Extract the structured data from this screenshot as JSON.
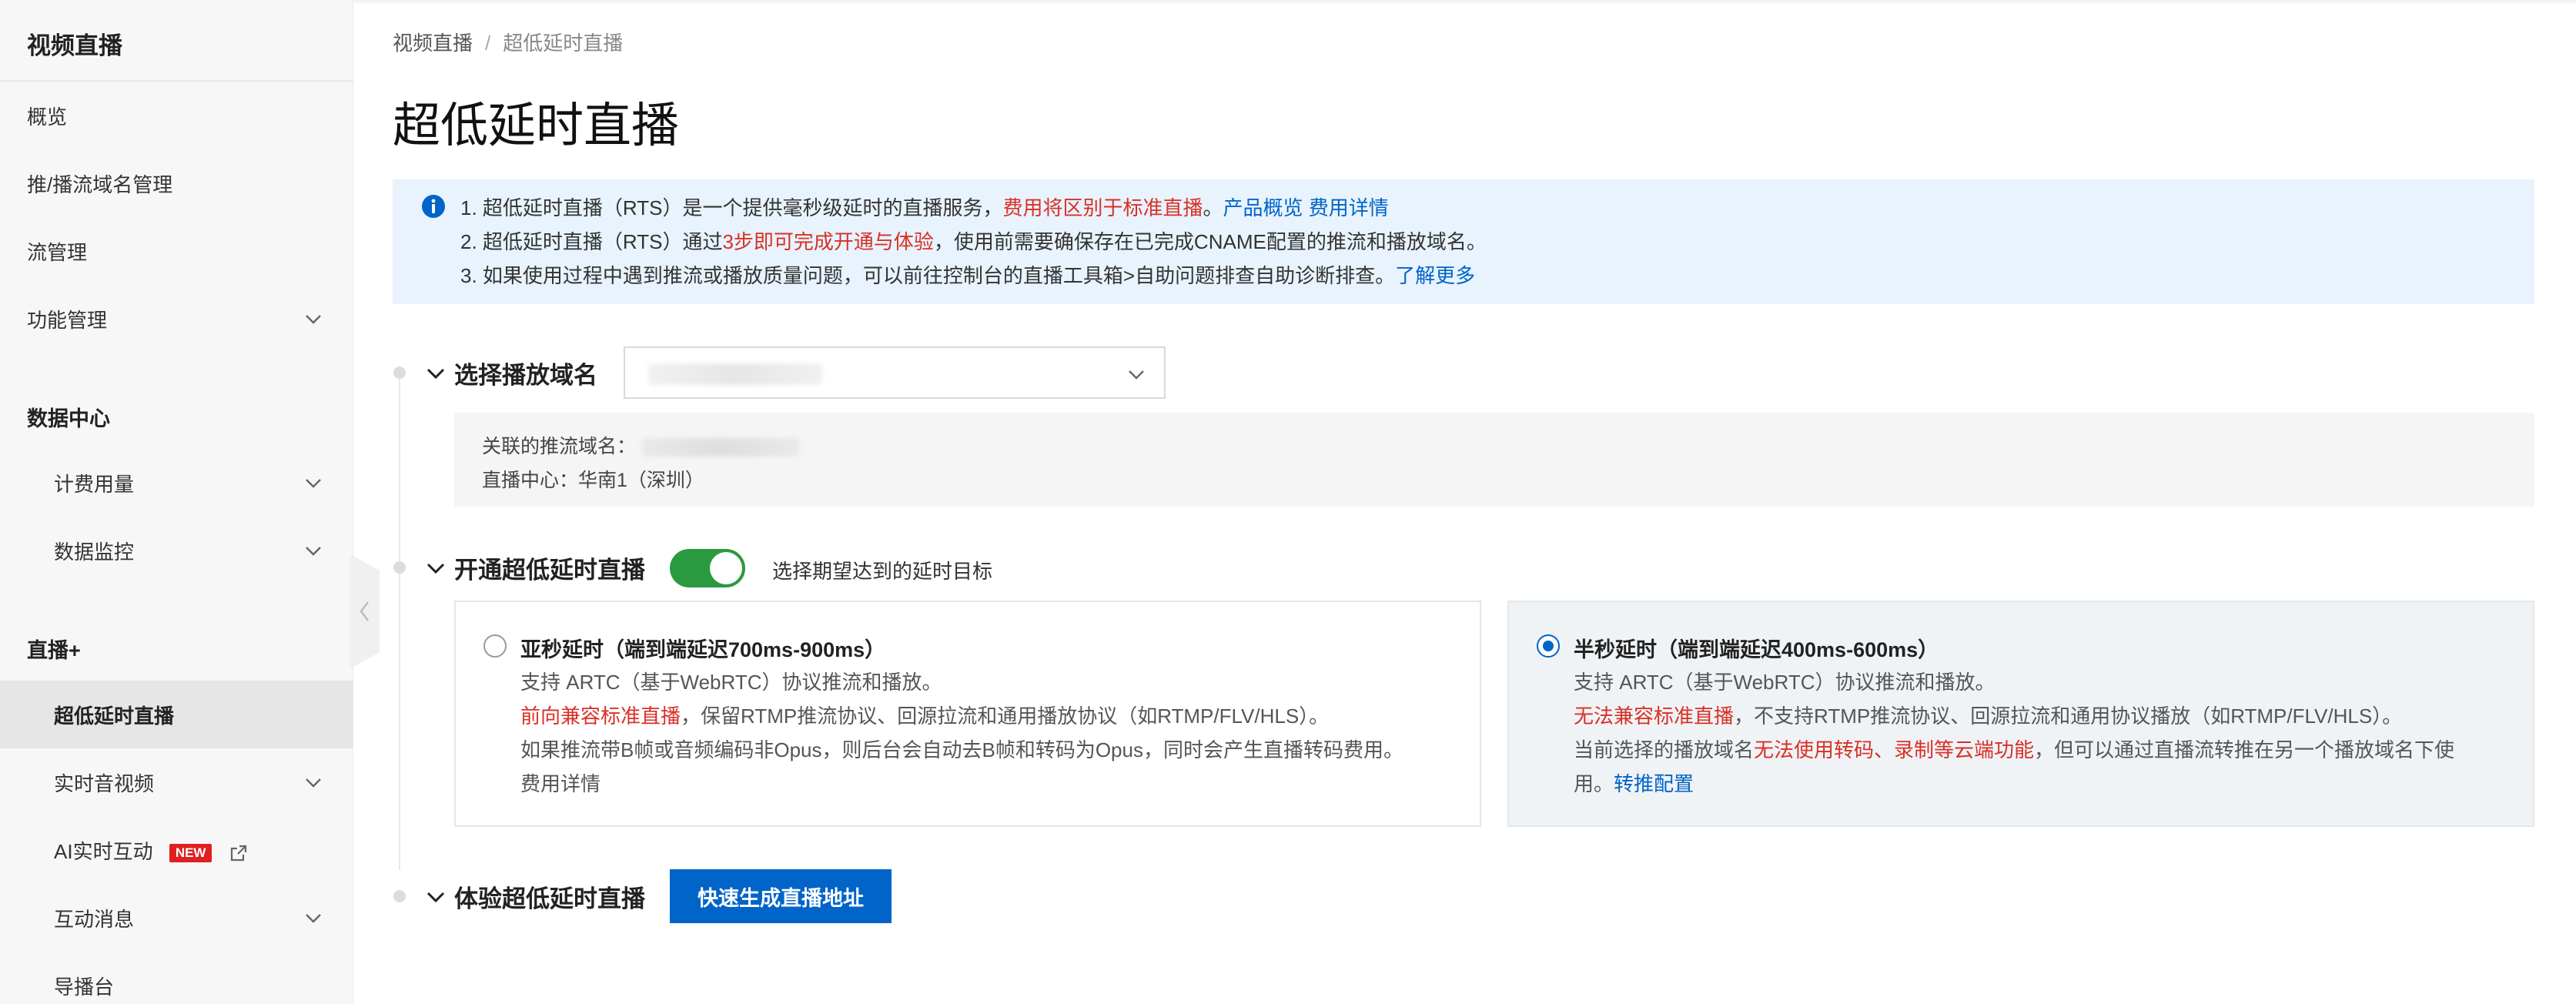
{
  "sidebar": {
    "title": "视频直播",
    "items": [
      {
        "label": "概览"
      },
      {
        "label": "推/播流域名管理"
      },
      {
        "label": "流管理"
      },
      {
        "label": "功能管理"
      }
    ],
    "group_data_center": "数据中心",
    "data_items": [
      {
        "label": "计费用量"
      },
      {
        "label": "数据监控"
      }
    ],
    "group_live_plus": "直播+",
    "live_items": [
      {
        "label": "超低延时直播"
      },
      {
        "label": "实时音视频"
      },
      {
        "label": "AI实时互动",
        "badge": "NEW"
      },
      {
        "label": "互动消息"
      },
      {
        "label": "导播台"
      }
    ]
  },
  "breadcrumb": {
    "root": "视频直播",
    "separator": "/",
    "current": "超低延时直播"
  },
  "page_title": "超低延时直播",
  "notice": {
    "line1": {
      "a": "1. 超低延时直播（RTS）是一个提供毫秒级延时的直播服务，",
      "b": "费用将区别于标准直播",
      "c": "。",
      "link1": "产品概览",
      "link2": "费用详情"
    },
    "line2": {
      "a": "2. 超低延时直播（RTS）通过",
      "b": "3步即可完成开通与体验",
      "c": "，使用前需要确保存在已完成CNAME配置的推流和播放域名。"
    },
    "line3": {
      "a": "3. 如果使用过程中遇到推流或播放质量问题，可以前往控制台的直播工具箱>自助问题排查自助诊断排查。",
      "link": "了解更多"
    }
  },
  "section_select": {
    "title": "选择播放域名",
    "push_domain_label": "关联的推流域名：",
    "center_label": "直播中心：",
    "center_value": "华南1（深圳）"
  },
  "section_enable": {
    "title": "开通超低延时直播",
    "toggle_on": true,
    "hint": "选择期望达到的延时目标",
    "options": [
      {
        "title": "亚秒延时（端到端延迟700ms-900ms）",
        "l1": "支持 ARTC（基于WebRTC）协议推流和播放。",
        "l2_red": "前向兼容标准直播",
        "l2": "，保留RTMP推流协议、回源拉流和通用播放协议（如RTMP/FLV/HLS）。",
        "l3": "如果推流带B帧或音频编码非Opus，则后台会自动去B帧和转码为Opus，同时会产生直播转码费用。",
        "link": "费用详情",
        "selected": false
      },
      {
        "title": "半秒延时（端到端延迟400ms-600ms）",
        "l1": "支持 ARTC（基于WebRTC）协议推流和播放。",
        "l2_red": "无法兼容标准直播",
        "l2": "，不支持RTMP推流协议、回源拉流和通用协议播放（如RTMP/FLV/HLS）。",
        "l3a": "当前选择的播放域名",
        "l3_red": "无法使用转码、录制等云端功能",
        "l3b": "，但可以通过直播流转推在另一个播放域名下使",
        "l4": "用。",
        "link": "转推配置",
        "selected": true
      }
    ]
  },
  "section_try": {
    "title": "体验超低延时直播",
    "button": "快速生成直播地址"
  },
  "colors": {
    "primary": "#0064c8",
    "danger": "#d93026",
    "toggle": "#2b9a3e",
    "notice_bg": "#e8f3fd"
  }
}
